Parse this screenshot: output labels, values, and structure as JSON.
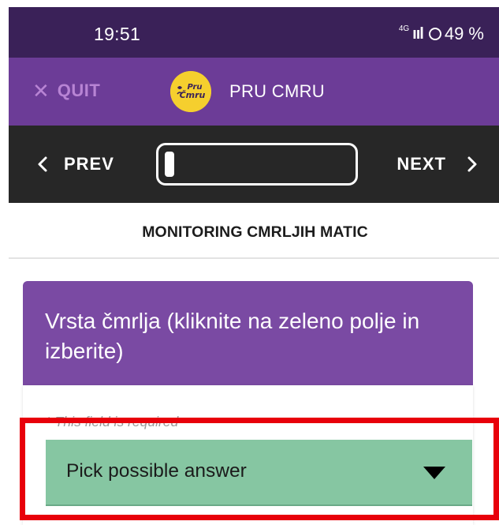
{
  "status_bar": {
    "time": "19:51",
    "network": "4G",
    "signal": "ııl",
    "battery": "49 %"
  },
  "header": {
    "quit_label": "QUIT",
    "quit_icon": "close-icon",
    "logo_text_top": "Pru",
    "logo_text_bottom": "Čmru",
    "title": "PRU CMRU",
    "brand_color": "#6c3c97"
  },
  "navigation": {
    "prev_label": "PREV",
    "next_label": "NEXT",
    "progress": 0.05
  },
  "survey": {
    "title": "MONITORING CMRLJIH MATIC"
  },
  "question": {
    "text": "Vrsta čmrlja (kliknite na zeleno polje in izberite)",
    "required_hint": "* This field is required",
    "select_value": "Pick possible answer",
    "select_color": "#86c6a2"
  },
  "annotation": {
    "highlight_color": "#e8000b"
  }
}
